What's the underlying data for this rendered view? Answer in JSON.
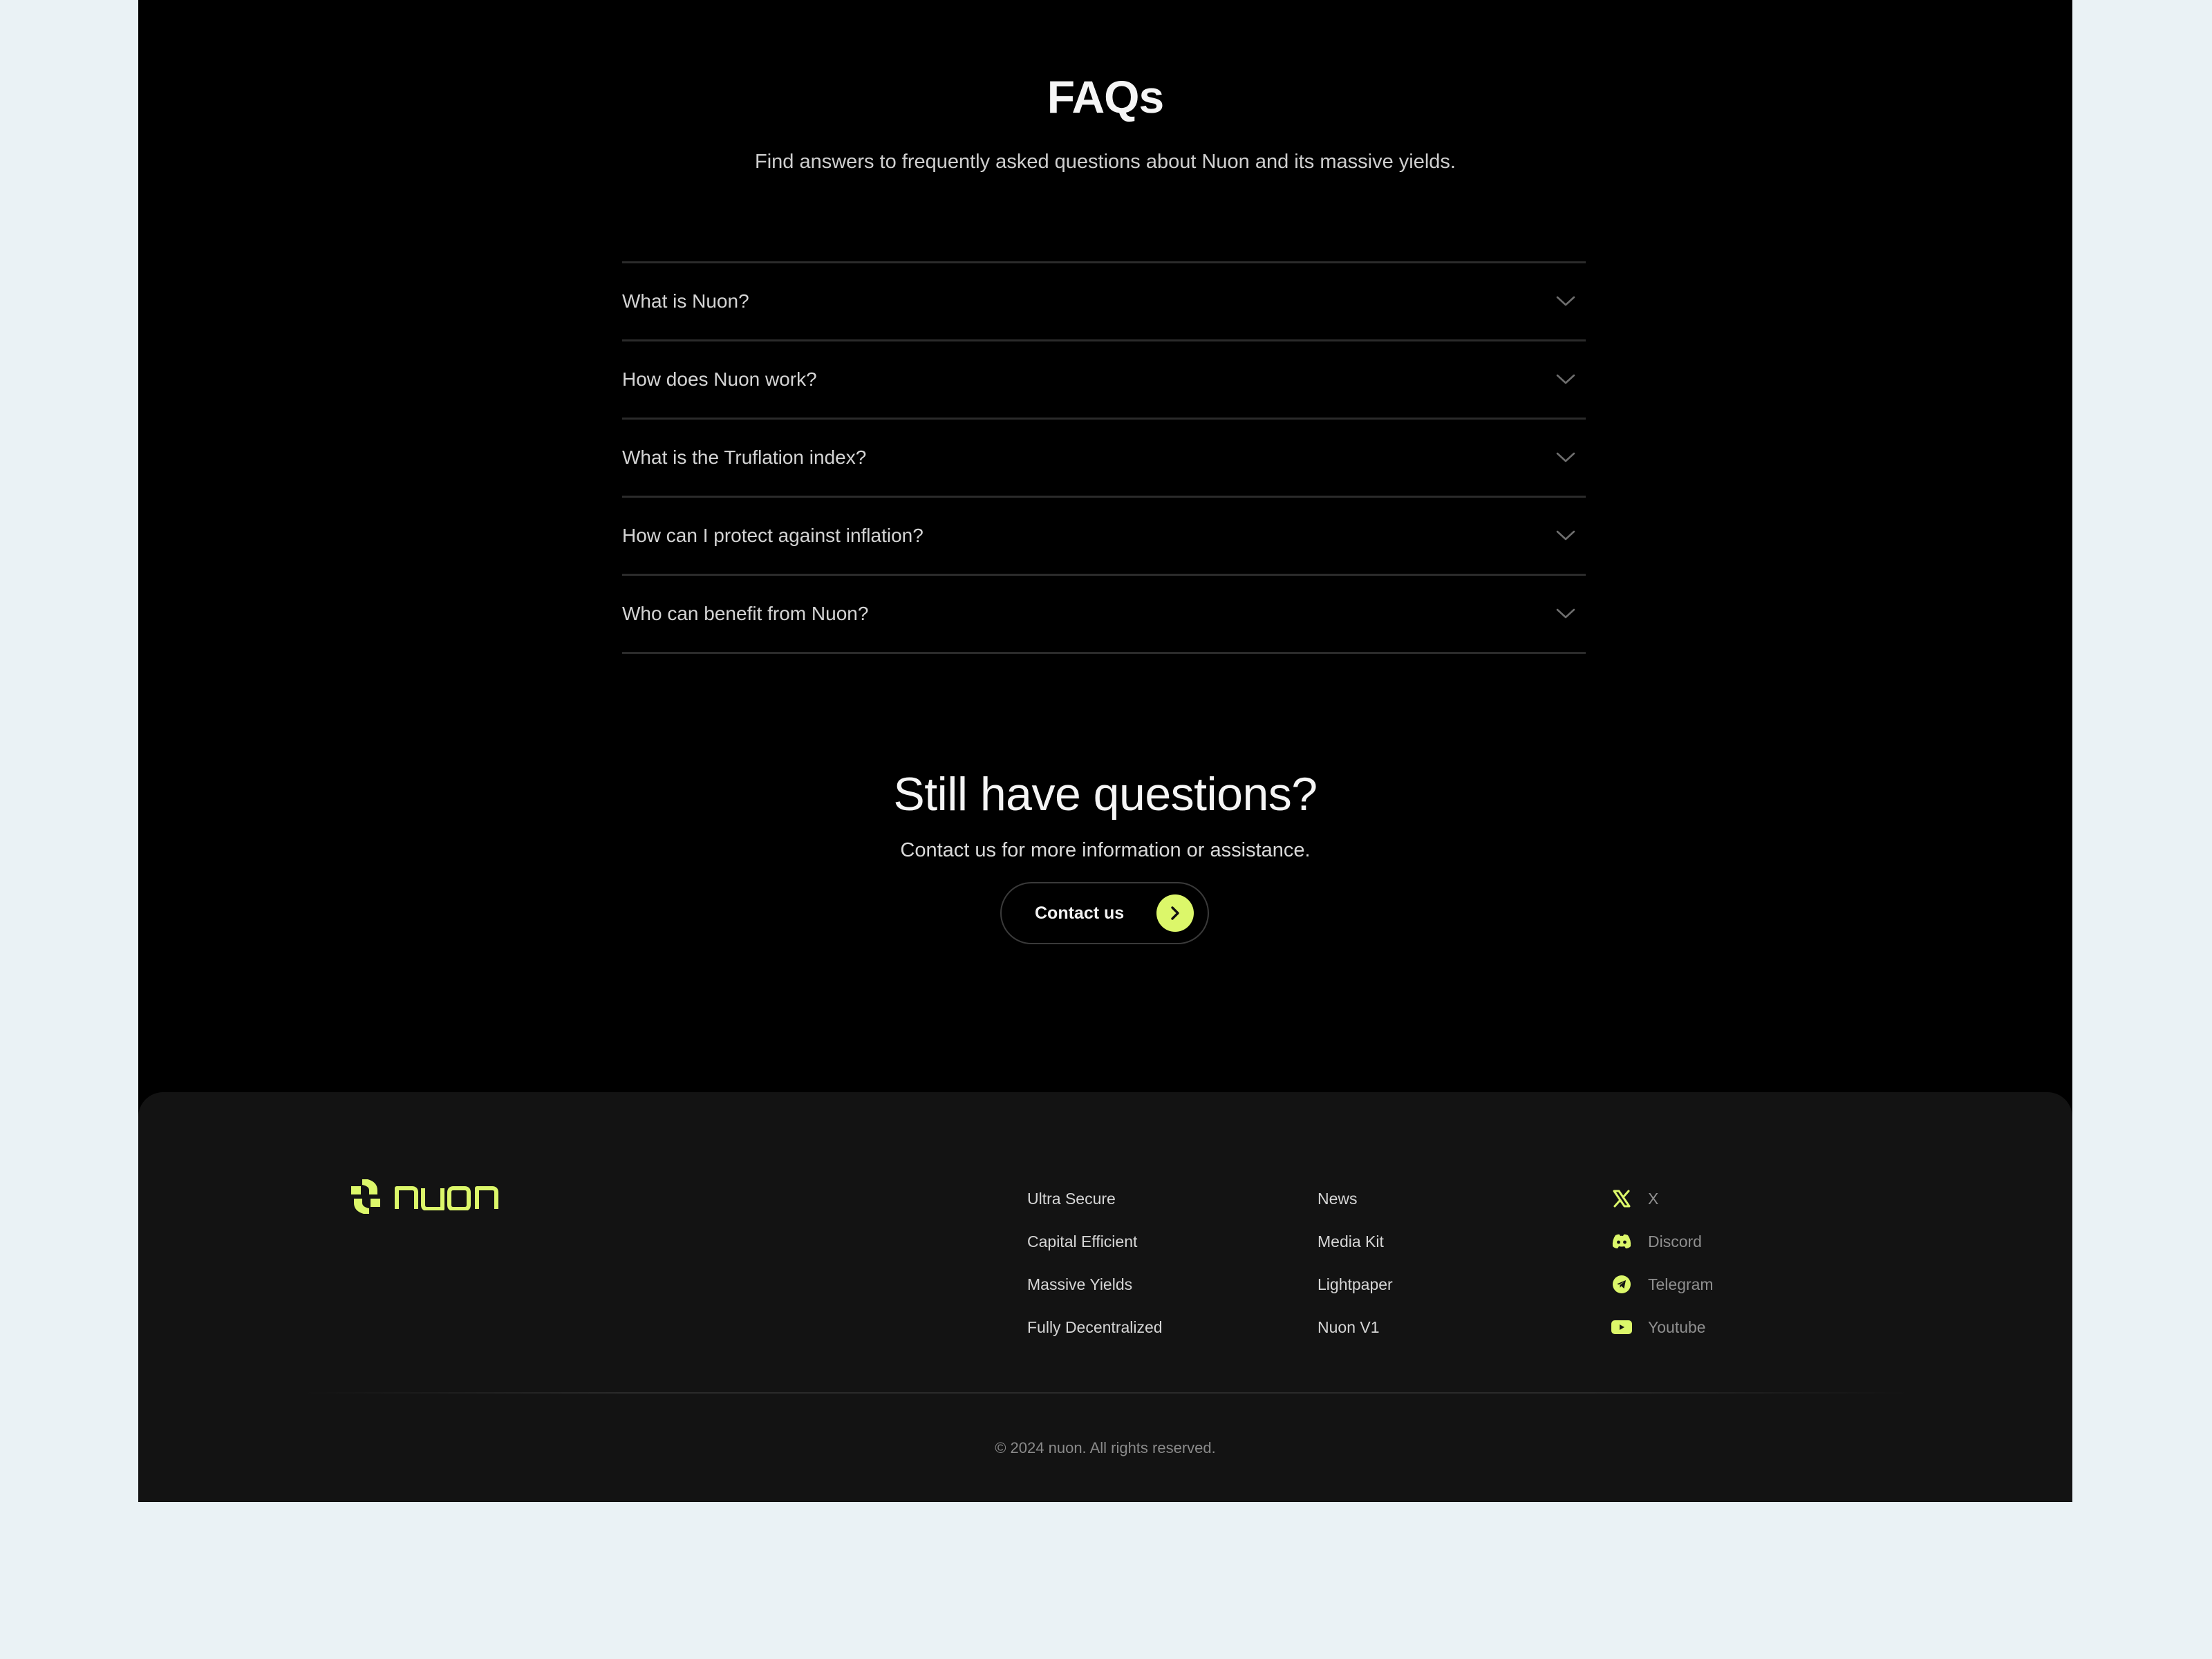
{
  "faq": {
    "title": "FAQs",
    "subtitle": "Find answers to frequently asked questions about Nuon and its massive yields.",
    "items": [
      {
        "question": "What is Nuon?",
        "icon": "chevron-down-icon"
      },
      {
        "question": "How does Nuon work?",
        "icon": "chevron-down-icon"
      },
      {
        "question": "What is the Truflation index?",
        "icon": "chevron-down-icon"
      },
      {
        "question": "How can I protect against inflation?",
        "icon": "chevron-down-icon"
      },
      {
        "question": "Who can benefit from Nuon?",
        "icon": "chevron-down-icon"
      }
    ]
  },
  "cta": {
    "title": "Still have questions?",
    "subtitle": "Contact us for more information or assistance.",
    "button_label": "Contact us",
    "button_icon": "arrow-right-icon"
  },
  "footer": {
    "logo_text": "nuon",
    "links_col1": [
      "Ultra Secure",
      "Capital Efficient",
      "Massive Yields",
      "Fully Decentralized"
    ],
    "links_col2": [
      "News",
      "Media Kit",
      "Lightpaper",
      "Nuon V1"
    ],
    "socials": [
      {
        "label": "X",
        "icon": "x-logo-icon"
      },
      {
        "label": "Discord",
        "icon": "discord-icon"
      },
      {
        "label": "Telegram",
        "icon": "telegram-icon"
      },
      {
        "label": "Youtube",
        "icon": "youtube-icon"
      }
    ],
    "copyright": "© 2024 nuon. All rights reserved."
  },
  "colors": {
    "accent": "#dcf76a",
    "page_background": "#eaf2f5",
    "section_background": "#000000",
    "footer_background": "#131313"
  }
}
